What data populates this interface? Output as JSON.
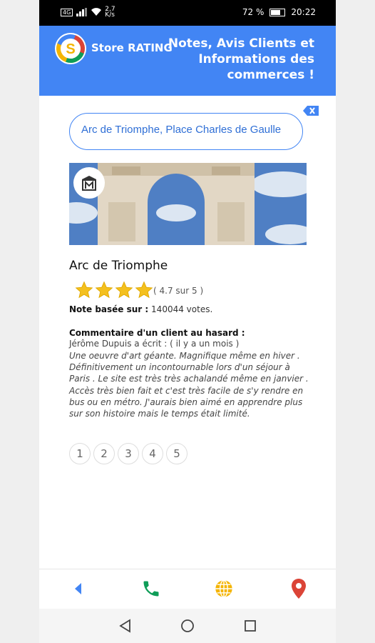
{
  "statusbar": {
    "network": "4G",
    "speed": "2,7\nK/s",
    "battery": "72 %",
    "time": "20:22"
  },
  "header": {
    "brand_prefix": "Store",
    "brand_suffix": "RATING",
    "tagline": "Notes, Avis Clients et Informations des commerces !"
  },
  "search": {
    "value": "Arc de Triomphe, Place Charles de Gaulle"
  },
  "place": {
    "name": "Arc de Triomphe",
    "rating": "( 4.7 sur 5 )",
    "votes_label": "Note basée sur :",
    "votes_value": "140044 votes."
  },
  "comment": {
    "heading": "Commentaire d'un client au hasard :",
    "author": "Jérôme Dupuis a écrit : ( il y a un mois )",
    "text": "Une oeuvre d'art géante. Magnifique même en hiver . Définitivement un incontournable lors d'un séjour à Paris . Le site est très très achalandé même en janvier . Accès très bien fait et c'est très facile de s'y rendre en bus ou en métro. J'aurais bien aimé en apprendre plus sur son histoire mais le temps était limité."
  },
  "pages": [
    "1",
    "2",
    "3",
    "4",
    "5"
  ],
  "colors": {
    "brand_blue": "#4285f4",
    "star": "#f4c01e",
    "phone": "#0f9d58",
    "globe": "#f4b400",
    "pin": "#db4437"
  },
  "icons": [
    "back-arrow-icon",
    "phone-icon",
    "globe-icon",
    "map-pin-icon"
  ]
}
